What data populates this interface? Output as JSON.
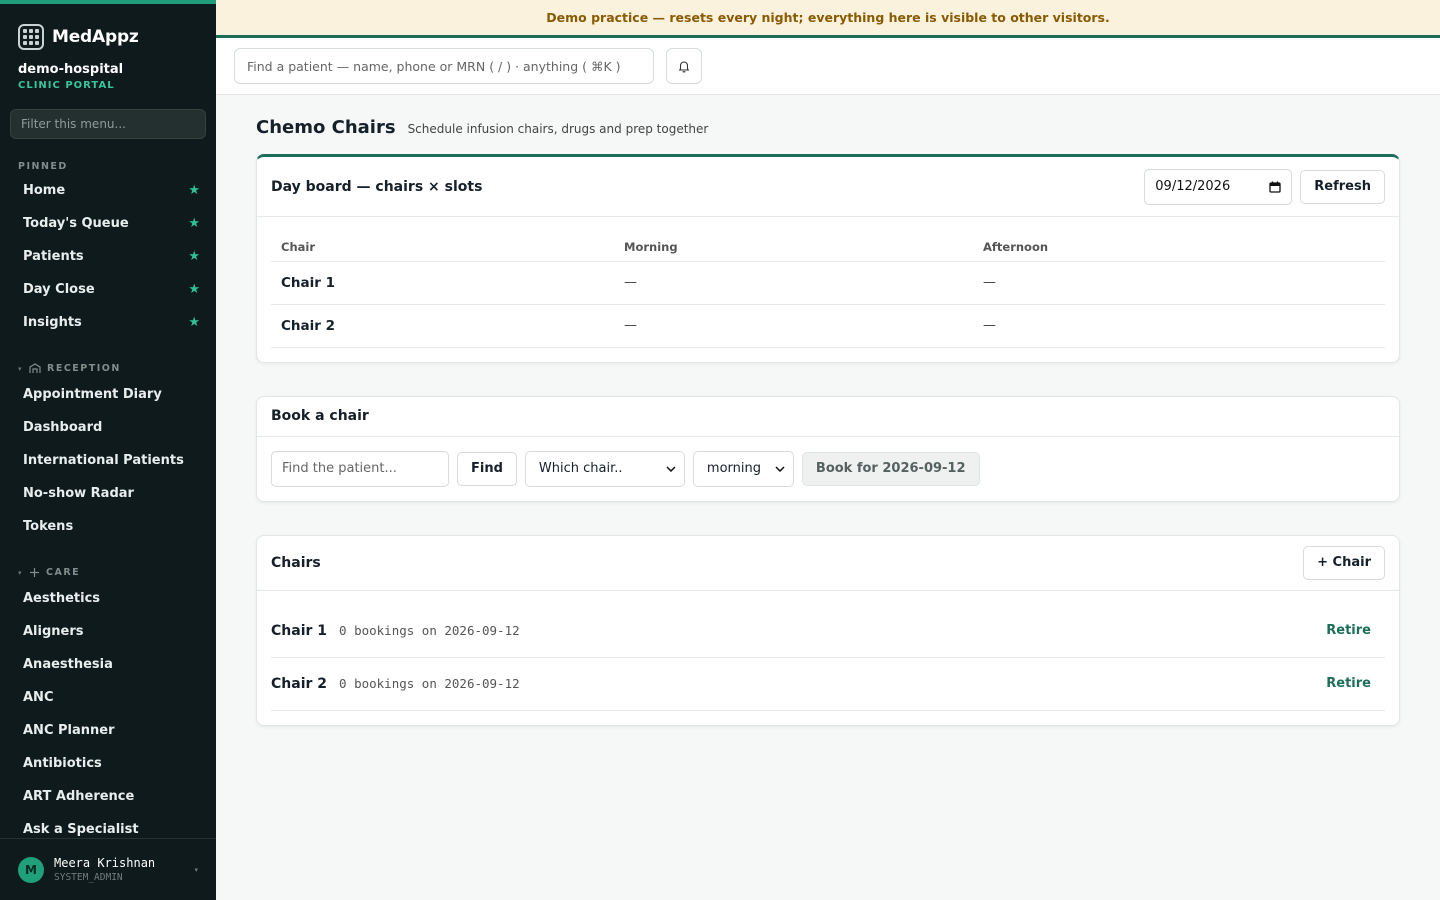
{
  "brand": {
    "name": "MedAppz"
  },
  "org": {
    "name": "demo-hospital",
    "subtitle": "CLINIC PORTAL"
  },
  "sidebar": {
    "filter_placeholder": "Filter this menu...",
    "pinned_label": "PINNED",
    "pinned": [
      {
        "label": "Home"
      },
      {
        "label": "Today's Queue"
      },
      {
        "label": "Patients"
      },
      {
        "label": "Day Close"
      },
      {
        "label": "Insights"
      }
    ],
    "reception_label": "RECEPTION",
    "reception": [
      {
        "label": "Appointment Diary"
      },
      {
        "label": "Dashboard"
      },
      {
        "label": "International Patients"
      },
      {
        "label": "No-show Radar"
      },
      {
        "label": "Tokens"
      }
    ],
    "care_label": "CARE",
    "care": [
      {
        "label": "Aesthetics"
      },
      {
        "label": "Aligners"
      },
      {
        "label": "Anaesthesia"
      },
      {
        "label": "ANC"
      },
      {
        "label": "ANC Planner"
      },
      {
        "label": "Antibiotics"
      },
      {
        "label": "ART Adherence"
      },
      {
        "label": "Ask a Specialist"
      }
    ],
    "star_glyph": "★",
    "caret_glyph": "▾"
  },
  "user": {
    "initial": "M",
    "name": "Meera Krishnan",
    "role": "SYSTEM_ADMIN"
  },
  "banner": {
    "text": "Demo practice — resets every night; everything here is visible to other visitors."
  },
  "topbar": {
    "search_placeholder": "Find a patient — name, phone or MRN ( / ) · anything ( ⌘K )"
  },
  "page": {
    "title": "Chemo Chairs",
    "subtitle": "Schedule infusion chairs, drugs and prep together"
  },
  "board": {
    "title": "Day board — chairs × slots",
    "date_value": "09/12/2026",
    "refresh_label": "Refresh",
    "columns": [
      "Chair",
      "Morning",
      "Afternoon"
    ],
    "rows": [
      {
        "chair": "Chair 1",
        "morning": "—",
        "afternoon": "—"
      },
      {
        "chair": "Chair 2",
        "morning": "—",
        "afternoon": "—"
      }
    ]
  },
  "book": {
    "title": "Book a chair",
    "patient_placeholder": "Find the patient...",
    "find_label": "Find",
    "chair_select_value": "Which chair..",
    "slot_select_value": "morning",
    "book_label": "Book for 2026-09-12"
  },
  "chairs": {
    "title": "Chairs",
    "add_label": "+ Chair",
    "items": [
      {
        "name": "Chair 1",
        "meta": "0 bookings on 2026-09-12",
        "action": "Retire"
      },
      {
        "name": "Chair 2",
        "meta": "0 bookings on 2026-09-12",
        "action": "Retire"
      }
    ]
  },
  "colors": {
    "accent": "#1c6e58",
    "sidebar_bg": "#0f1a1c",
    "star": "#2fc193",
    "banner_bg": "#fbf2de",
    "banner_text": "#8a5a00"
  }
}
